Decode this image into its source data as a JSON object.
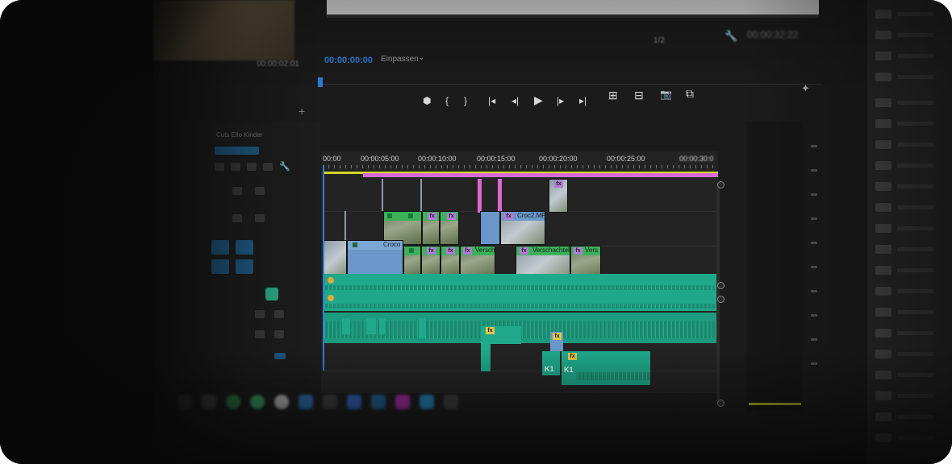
{
  "source_monitor": {
    "timecode": "00:00:02:01"
  },
  "program_monitor": {
    "timecode": "00:00:00:00",
    "fit_label": "Einpassen",
    "resolution": "1/2",
    "duration_timecode": "00:00:32:22"
  },
  "transport": {
    "marker": "⬢",
    "in_point": "{",
    "out_point": "}",
    "go_to_in": "|◂",
    "step_back": "◂|",
    "play": "▶",
    "step_forward": "|▸",
    "go_to_out": "▸|",
    "insert": "⊞",
    "overwrite": "⊟",
    "export_frame": "📷",
    "compare": "⧉"
  },
  "sequence": {
    "name": "Cuts Ello Kinder"
  },
  "timeline": {
    "ruler_labels": [
      "00:00",
      "00:00:05:00",
      "00:00:10:00",
      "00:00:15:00",
      "00:00:20:00",
      "00:00:25:00",
      "00:00:30:0"
    ],
    "clips": {
      "c1_name": "Croco",
      "c2_name": "Croc2.MP",
      "c3_name": "Verschacht",
      "c4_name": "Verschachtel",
      "c5_name": "Vers"
    },
    "audio_labels": {
      "k1": "K1",
      "k2": "K1"
    }
  },
  "colors": {
    "accent_blue": "#2e7ed8",
    "video_clip_header": "#3cb15a",
    "audio_clip": "#1fa98a",
    "work_area": "#d4d42a",
    "marker_pink": "#e067d0"
  }
}
